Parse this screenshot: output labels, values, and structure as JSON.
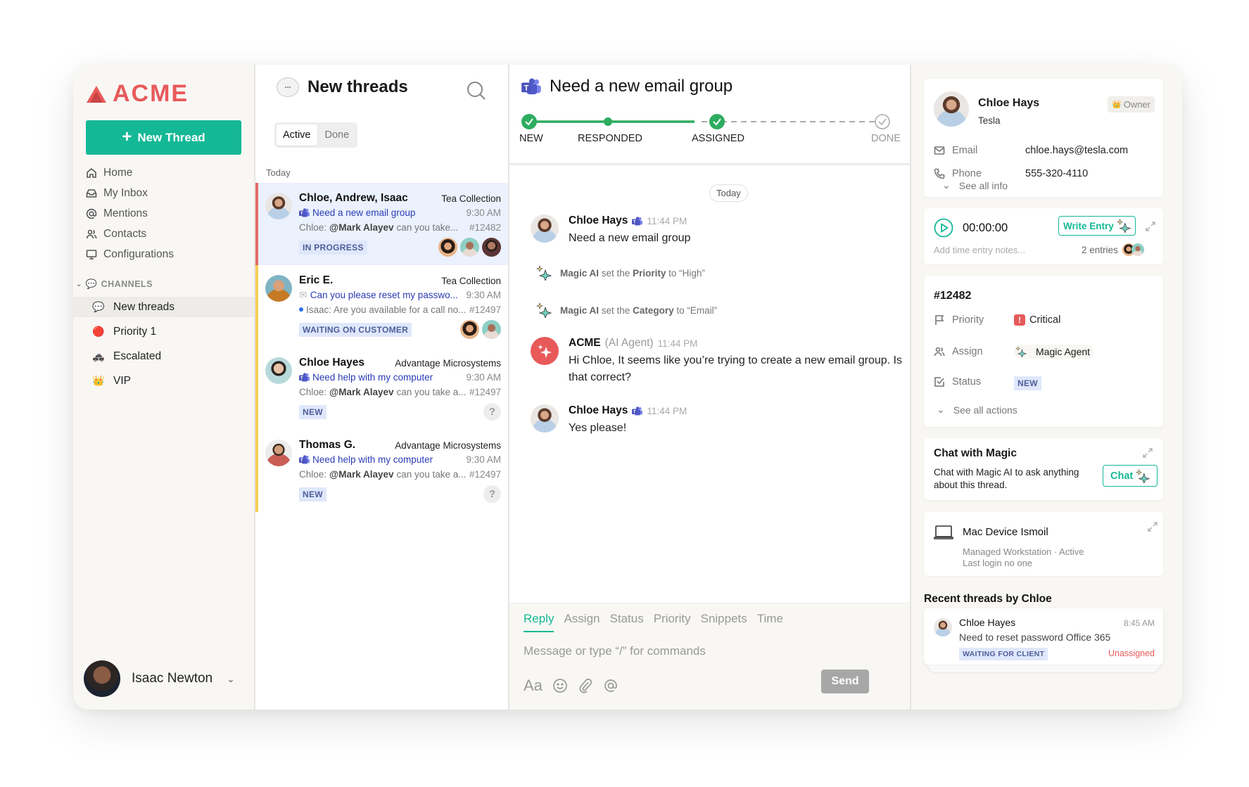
{
  "app": {
    "brand": "ACME",
    "accent": "#14b896",
    "brand_color": "#e85a5a"
  },
  "sidebar": {
    "new_thread_label": "New Thread",
    "nav": [
      {
        "label": "Home",
        "icon": "home-icon"
      },
      {
        "label": "My Inbox",
        "icon": "inbox-icon"
      },
      {
        "label": "Mentions",
        "icon": "at-icon"
      },
      {
        "label": "Contacts",
        "icon": "contacts-icon"
      },
      {
        "label": "Configurations",
        "icon": "monitor-icon"
      }
    ],
    "channels_header": "CHANNELS",
    "channels": [
      {
        "label": "New threads",
        "emoji": "💬",
        "active": true
      },
      {
        "label": "Priority 1",
        "emoji": "🔴"
      },
      {
        "label": "Escalated",
        "emoji": "🚓"
      },
      {
        "label": "VIP",
        "emoji": "👑"
      }
    ],
    "user": {
      "name": "Isaac Newton"
    }
  },
  "thread_list": {
    "title": "New threads",
    "tabs": [
      "Active",
      "Done"
    ],
    "active_tab": "Active",
    "group_label": "Today",
    "threads": [
      {
        "name": "Chloe, Andrew, Isaac",
        "org": "Tea Collection",
        "channel": "teams",
        "subject": "Need a new email group",
        "time": "9:30 AM",
        "preview_sender": "Chloe:",
        "preview_mention": "@Mark Alayev",
        "preview_text": "can you take...",
        "id": "#12482",
        "status": "IN PROGRESS",
        "selected": true
      },
      {
        "name": "Eric E.",
        "org": "Tea Collection",
        "channel": "email",
        "subject": "Can you please reset my passwo...",
        "time": "9:30 AM",
        "preview_sender": "",
        "preview_mention": "",
        "preview_text": "Isaac: Are you available for a call no...",
        "id": "#12497",
        "status": "WAITING ON CUSTOMER",
        "unread": true
      },
      {
        "name": "Chloe Hayes",
        "org": "Advantage Microsystems",
        "channel": "teams",
        "subject": "Need help with my computer",
        "time": "9:30 AM",
        "preview_sender": "Chloe:",
        "preview_mention": "@Mark Alayev",
        "preview_text": "can you take a...",
        "id": "#12497",
        "status": "NEW",
        "assignee": "?"
      },
      {
        "name": "Thomas G.",
        "org": "Advantage Microsystems",
        "channel": "teams",
        "subject": "Need help with my computer",
        "time": "9:30 AM",
        "preview_sender": "Chloe:",
        "preview_mention": "@Mark Alayev",
        "preview_text": "can you take a...",
        "id": "#12497",
        "status": "NEW",
        "assignee": "?"
      }
    ]
  },
  "conversation": {
    "title": "Need a new email group",
    "steps": [
      {
        "label": "NEW",
        "state": "done"
      },
      {
        "label": "RESPONDED",
        "state": "done"
      },
      {
        "label": "ASSIGNED",
        "state": "done"
      },
      {
        "label": "DONE",
        "state": "pending"
      }
    ],
    "day_label": "Today",
    "messages": [
      {
        "author": "Chloe Hays",
        "role": "",
        "time": "11:44 PM",
        "body": "Need a new email group"
      },
      {
        "author": "ACME",
        "role": "(AI Agent)",
        "time": "11:44 PM",
        "body": "Hi Chloe, It seems like you’re trying to create a new email group. Is that correct?"
      },
      {
        "author": "Chloe Hays",
        "role": "",
        "time": "11:44 PM",
        "body": "Yes please!"
      }
    ],
    "events": [
      {
        "actor": "Magic AI",
        "pre": "set the",
        "field": "Priority",
        "post": "to “High”"
      },
      {
        "actor": "Magic AI",
        "pre": "set the",
        "field": "Category",
        "post": "to “Email”"
      }
    ],
    "composer": {
      "tabs": [
        "Reply",
        "Assign",
        "Status",
        "Priority",
        "Snippets",
        "Time"
      ],
      "active_tab": "Reply",
      "placeholder": "Message or type “/” for commands",
      "format_label": "Aa",
      "send_label": "Send"
    }
  },
  "details": {
    "contact": {
      "name": "Chloe Hays",
      "org": "Tesla",
      "role_badge": "Owner",
      "email_label": "Email",
      "email": "chloe.hays@tesla.com",
      "phone_label": "Phone",
      "phone": "555-320-4110",
      "see_all": "See all info"
    },
    "timer": {
      "value": "00:00:00",
      "write_label": "Write Entry",
      "notes_placeholder": "Add time entry notes...",
      "entries": "2 entries"
    },
    "ticket": {
      "id": "#12482",
      "priority_label": "Priority",
      "priority": "Critical",
      "assign_label": "Assign",
      "assignee": "Magic Agent",
      "status_label": "Status",
      "status": "NEW",
      "see_all": "See all actions"
    },
    "magic_chat": {
      "title": "Chat with Magic",
      "description": "Chat with Magic AI to ask anything about this thread.",
      "button": "Chat"
    },
    "device": {
      "name": "Mac Device Ismoil",
      "line1": "Managed Workstation · Active",
      "line2": "Last login no one"
    },
    "recent": {
      "header": "Recent threads by Chloe",
      "items": [
        {
          "name": "Chloe Hayes",
          "time": "8:45 AM",
          "subject": "Need to reset password Office 365",
          "status": "WAITING FOR CLIENT",
          "assignee": "Unassigned"
        }
      ]
    }
  }
}
